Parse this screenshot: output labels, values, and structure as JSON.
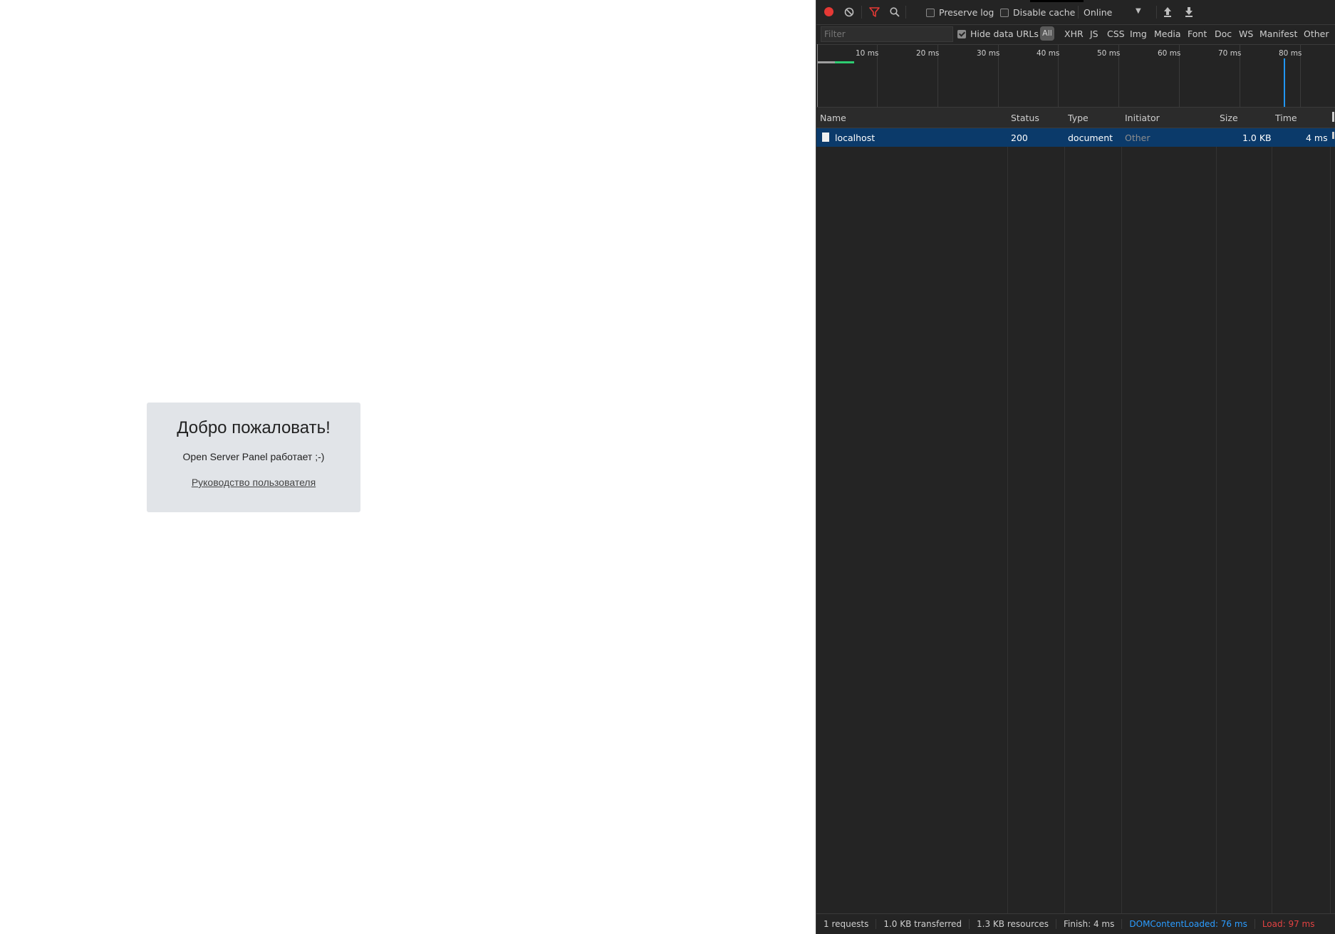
{
  "page": {
    "welcome_title": "Добро пожаловать!",
    "welcome_text": "Open Server Panel работает ;-)",
    "guide_link": "Руководство пользователя"
  },
  "toolbar": {
    "preserve_log": "Preserve log",
    "disable_cache": "Disable cache",
    "throttle": "Online"
  },
  "filterbar": {
    "filter_placeholder": "Filter",
    "hide_data_urls": "Hide data URLs",
    "all": "All",
    "types": [
      "XHR",
      "JS",
      "CSS",
      "Img",
      "Media",
      "Font",
      "Doc",
      "WS",
      "Manifest",
      "Other"
    ]
  },
  "overview": {
    "ticks": [
      "10 ms",
      "20 ms",
      "30 ms",
      "40 ms",
      "50 ms",
      "60 ms",
      "70 ms",
      "80 ms"
    ]
  },
  "table": {
    "headers": [
      "Name",
      "Status",
      "Type",
      "Initiator",
      "Size",
      "Time"
    ],
    "rows": [
      {
        "name": "localhost",
        "status": "200",
        "type": "document",
        "initiator": "Other",
        "size": "1.0 KB",
        "time": "4 ms"
      }
    ]
  },
  "status": {
    "requests": "1 requests",
    "transferred": "1.0 KB transferred",
    "resources": "1.3 KB resources",
    "finish": "Finish: 4 ms",
    "dcl": "DOMContentLoaded: 76 ms",
    "load": "Load: 97 ms"
  },
  "colors": {
    "record": "#e53935",
    "selected_row": "#0b3a6a",
    "dcl": "#2b9cff",
    "load": "#e34242"
  }
}
